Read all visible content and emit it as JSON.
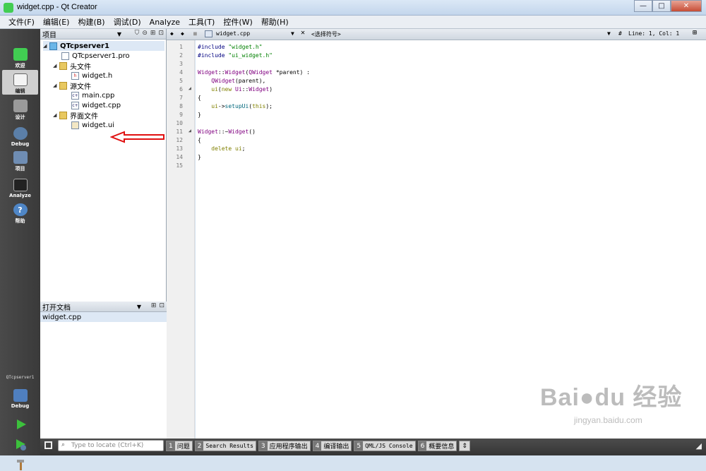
{
  "window": {
    "title": "widget.cpp - Qt Creator",
    "controls": [
      "—",
      "□",
      "✕"
    ]
  },
  "menu": [
    "文件(F)",
    "编辑(E)",
    "构建(B)",
    "调试(D)",
    "Analyze",
    "工具(T)",
    "控件(W)",
    "帮助(H)"
  ],
  "modes": [
    {
      "label": "欢迎",
      "icon": "qt-logo-icon",
      "active": false
    },
    {
      "label": "编辑",
      "icon": "edit-document-icon",
      "active": true
    },
    {
      "label": "设计",
      "icon": "design-tools-icon",
      "active": false
    },
    {
      "label": "Debug",
      "icon": "debug-bug-icon",
      "active": false
    },
    {
      "label": "项目",
      "icon": "project-icon",
      "active": false
    },
    {
      "label": "Analyze",
      "icon": "analyze-monitor-icon",
      "active": false
    },
    {
      "label": "帮助",
      "icon": "help-icon",
      "active": false
    }
  ],
  "kit": {
    "project": "QTcpserver1",
    "build": "Debug"
  },
  "project_pane": {
    "header": "项目",
    "open_docs_header": "打开文档",
    "open_docs": [
      "widget.cpp"
    ]
  },
  "tree": [
    {
      "label": "QTcpserver1",
      "level": 0,
      "kind": "project",
      "expanded": true,
      "bold": true
    },
    {
      "label": "QTcpserver1.pro",
      "level": 1,
      "kind": "file"
    },
    {
      "label": "头文件",
      "level": 1,
      "kind": "folder",
      "expanded": true
    },
    {
      "label": "widget.h",
      "level": 2,
      "kind": "header"
    },
    {
      "label": "源文件",
      "level": 1,
      "kind": "folder",
      "expanded": true
    },
    {
      "label": "main.cpp",
      "level": 2,
      "kind": "cpp"
    },
    {
      "label": "widget.cpp",
      "level": 2,
      "kind": "cpp"
    },
    {
      "label": "界面文件",
      "level": 1,
      "kind": "folder",
      "expanded": true
    },
    {
      "label": "widget.ui",
      "level": 2,
      "kind": "form"
    }
  ],
  "editor": {
    "file": "widget.cpp",
    "symbol": "<选择符号>",
    "cursor": "Line: 1, Col: 1"
  },
  "code_lines": [
    "#include \"widget.h\"",
    "#include \"ui_widget.h\"",
    "",
    "Widget::Widget(QWidget *parent) :",
    "    QWidget(parent),",
    "    ui(new Ui::Widget)",
    "{",
    "    ui->setupUi(this);",
    "}",
    "",
    "Widget::~Widget()",
    "{",
    "    delete ui;",
    "}",
    ""
  ],
  "fold_markers": [
    6,
    11
  ],
  "locator": {
    "placeholder": "Type to locate (Ctrl+K)"
  },
  "output_tabs": [
    {
      "num": "1",
      "label": "问题"
    },
    {
      "num": "2",
      "label": "Search Results"
    },
    {
      "num": "3",
      "label": "应用程序输出"
    },
    {
      "num": "4",
      "label": "编译输出"
    },
    {
      "num": "5",
      "label": "QML/JS Console"
    },
    {
      "num": "6",
      "label": "概要信息"
    }
  ],
  "watermark": {
    "brand": "Bai●du 经验",
    "url": "jingyan.baidu.com"
  },
  "colors": {
    "annotation_arrow": "#e01010",
    "mode_bar": "#404040",
    "run_green": "#3cc13c"
  }
}
